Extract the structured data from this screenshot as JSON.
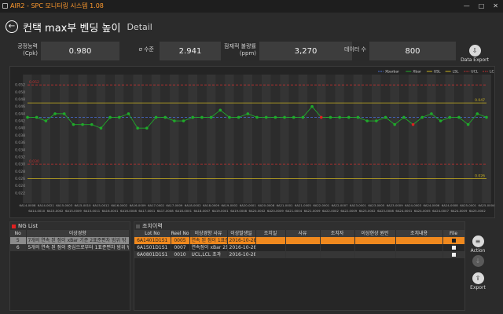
{
  "window": {
    "title": "AIR2 - SPC 모니터링 시스템 1.08",
    "minimize": "—",
    "maximize": "□",
    "close": "✕"
  },
  "header": {
    "back_icon": "arrow-left-icon",
    "title": "컨택 max부 벤딩 높이",
    "subtitle": "Detail"
  },
  "metrics": [
    {
      "label_line1": "공정능력",
      "label_line2": "(Cpk)",
      "value": "0.980"
    },
    {
      "label_line1": "σ 수준",
      "label_line2": "",
      "value": "2.941"
    },
    {
      "label_line1": "잠재적 불량률",
      "label_line2": "(ppm)",
      "value": "3,270"
    },
    {
      "label_line1": "데이터 수",
      "label_line2": "",
      "value": "800"
    }
  ],
  "data_export": {
    "label": "Data Export",
    "icon": "data-export-icon"
  },
  "chart_data": {
    "type": "line",
    "ylim": [
      0.02,
      0.054
    ],
    "y_ticks": [
      0.022,
      0.024,
      0.026,
      0.028,
      0.03,
      0.032,
      0.034,
      0.036,
      0.038,
      0.04,
      0.042,
      0.044,
      0.046,
      0.048,
      0.05,
      0.052
    ],
    "legend_position": "top-right",
    "legend": [
      {
        "name": "Xbarbar",
        "color": "#4a6fd8",
        "dash": true
      },
      {
        "name": "Xbar",
        "color": "#1faa2a",
        "dash": false
      },
      {
        "name": "USL",
        "color": "#c8b020",
        "dash": false
      },
      {
        "name": "LSL",
        "color": "#c8b020",
        "dash": false
      },
      {
        "name": "UCL",
        "color": "#c03030",
        "dash": true
      },
      {
        "name": "LCL",
        "color": "#c03030",
        "dash": true
      }
    ],
    "reference_lines": [
      {
        "name": "UCL",
        "value": 0.052,
        "color": "#c03030",
        "dash": true,
        "label": "0.052",
        "label_side": "left"
      },
      {
        "name": "USL",
        "value": 0.047,
        "color": "#c8b020",
        "dash": false,
        "label": "0.047",
        "label_side": "right"
      },
      {
        "name": "Xbarbar",
        "value": 0.043,
        "color": "#4a6fd8",
        "dash": true,
        "label": "",
        "label_side": "right"
      },
      {
        "name": "LSL",
        "value": 0.026,
        "color": "#c8b020",
        "dash": false,
        "label": "0.026",
        "label_side": "right"
      },
      {
        "name": "LCL",
        "value": 0.03,
        "color": "#c03030",
        "dash": true,
        "label": "0.030",
        "label_side": "left"
      }
    ],
    "categories": [
      "6A14-0008",
      "6A14-0010",
      "6A14-0021",
      "6A15-0002",
      "6A15-0003",
      "6A15-0009",
      "6A15-0010",
      "6A15-0011",
      "6A15-0012",
      "6A16-0001",
      "6A16-0002",
      "6A16-0008",
      "6A16-0009",
      "6A17-0001",
      "6A17-0002",
      "6A17-0008",
      "6A17-0009",
      "6A18-0001",
      "6A18-0002",
      "6A18-0007",
      "6A18-0009",
      "6A19-0001",
      "6A19-0002",
      "6A19-0008",
      "6A20-0001",
      "6A20-0002",
      "6A20-0008",
      "6A20-0009",
      "6A21-0001",
      "6A21-0004",
      "6A21-0005",
      "6A21-0009",
      "6A22-0001",
      "6A22-0002",
      "6A22-0007",
      "6A22-0009",
      "6A23-0001",
      "6A23-0002",
      "6A23-0005",
      "6A23-0008",
      "6A23-0009",
      "6A24-0001",
      "6A24-0003",
      "6A24-0005",
      "6A24-0006",
      "6A24-0007",
      "6A24-0008",
      "6A24-0009",
      "6A25-0001",
      "6A25-0002",
      "6A25-0004"
    ],
    "series": [
      {
        "name": "Xbar",
        "color": "#1faa2a",
        "flag_color": "#e02020",
        "flagged_indices": [
          32,
          42
        ],
        "values": [
          0.043,
          0.043,
          0.042,
          0.044,
          0.044,
          0.041,
          0.041,
          0.041,
          0.04,
          0.043,
          0.043,
          0.044,
          0.04,
          0.04,
          0.043,
          0.043,
          0.042,
          0.042,
          0.043,
          0.043,
          0.043,
          0.045,
          0.043,
          0.043,
          0.044,
          0.043,
          0.043,
          0.043,
          0.043,
          0.043,
          0.043,
          0.046,
          0.043,
          0.043,
          0.043,
          0.043,
          0.043,
          0.042,
          0.042,
          0.043,
          0.041,
          0.043,
          0.041,
          0.043,
          0.044,
          0.042,
          0.043,
          0.043,
          0.041,
          0.044,
          0.043
        ]
      }
    ]
  },
  "ng_list": {
    "title": "NG List",
    "columns": [
      "No",
      "이상경향"
    ],
    "rows": [
      {
        "no": "5",
        "trend": "7개의 연속 된 점이 xBar 기준 2표준편차 범위 밖"
      },
      {
        "no": "6",
        "trend": "5개의 연속 된 점이 중심으로부터 1표준편차 범위 밖"
      }
    ]
  },
  "action_list": {
    "title": "조치이력",
    "columns": [
      "Lot No",
      "Reel No",
      "이상경향 사유",
      "이상발생일",
      "조치일",
      "사유",
      "조치자",
      "이상현상 원인",
      "조치내용",
      "File"
    ],
    "rows": [
      {
        "lot": "6A1401D1S1",
        "reel": "0005",
        "trend": "연속 된 점이 1표준편차 범위 밖",
        "occurred": "2016-10-28"
      },
      {
        "lot": "6A1501D1S1",
        "reel": "0007",
        "trend": "연속점이 xBar 2표준편차 범위 밖",
        "occurred": "2016-10-28"
      },
      {
        "lot": "6A0801D1S1",
        "reel": "0010",
        "trend": "UCL,LCL 초과",
        "occurred": "2016-10-28"
      }
    ]
  },
  "side_buttons": {
    "action": "Action",
    "export": "Export"
  }
}
